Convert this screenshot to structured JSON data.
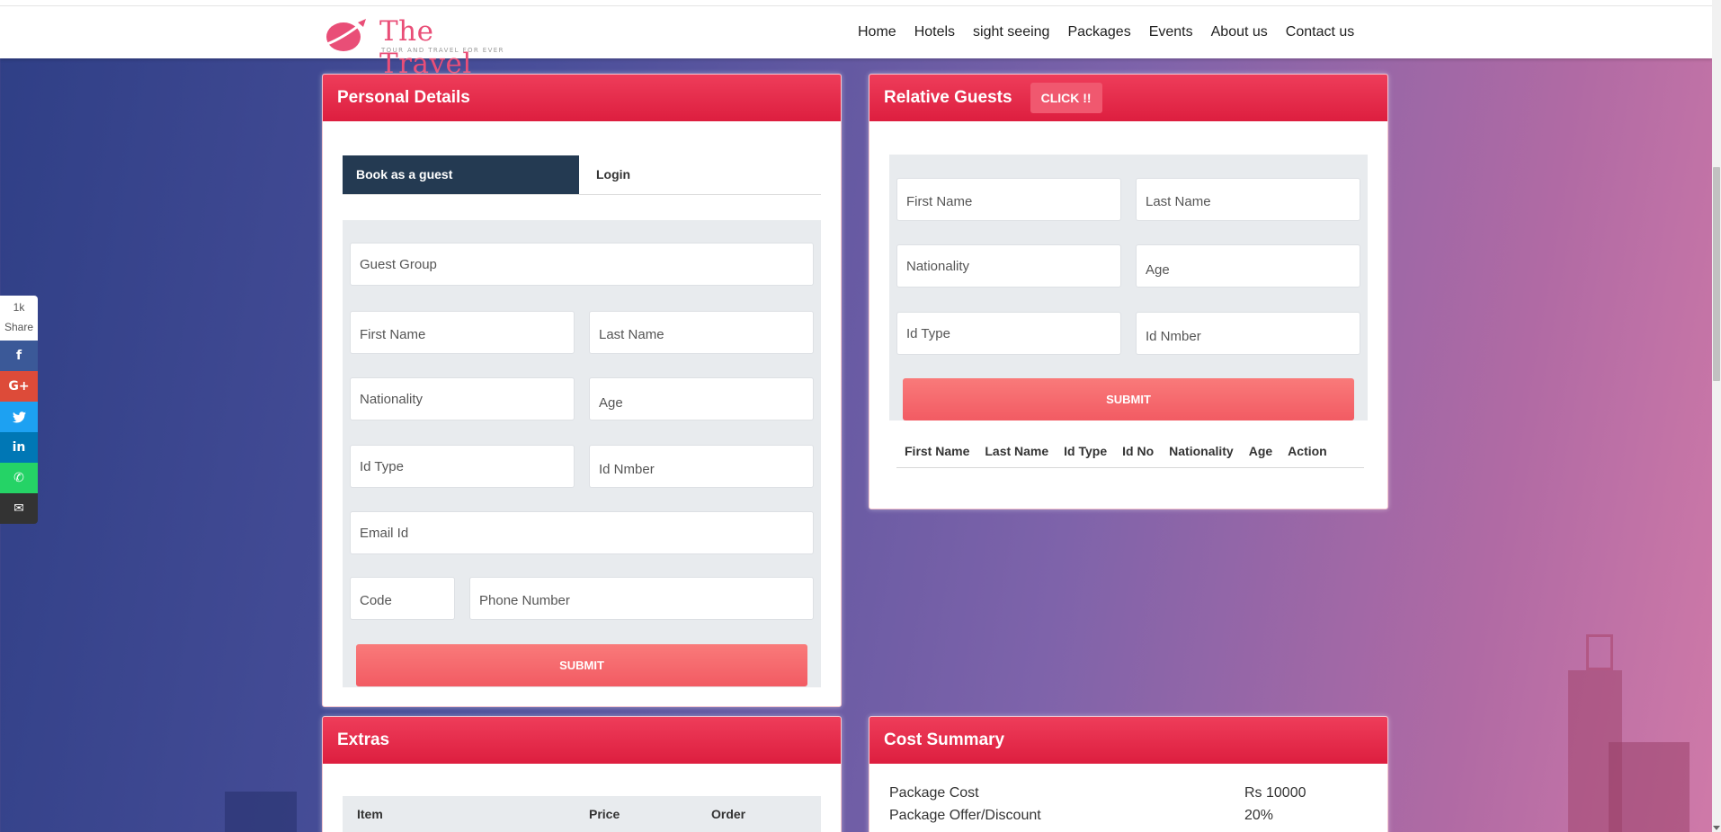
{
  "brand": {
    "title": "The Travel",
    "tagline": "TOUR AND TRAVEL FOR EVER",
    "color": "#e94e77"
  },
  "nav": [
    "Home",
    "Hotels",
    "sight seeing",
    "Packages",
    "Events",
    "About us",
    "Contact us"
  ],
  "share": {
    "count": "1k",
    "label": "Share",
    "buttons": [
      {
        "icon": "facebook-icon",
        "glyph": "f",
        "color": "#3b5998"
      },
      {
        "icon": "google-plus-icon",
        "glyph": "G+",
        "color": "#dd4b39"
      },
      {
        "icon": "twitter-icon",
        "glyph": "🐦",
        "color": "#1da1f2"
      },
      {
        "icon": "linkedin-icon",
        "glyph": "in",
        "color": "#0077b5"
      },
      {
        "icon": "whatsapp-icon",
        "glyph": "✆",
        "color": "#25d366"
      },
      {
        "icon": "email-icon",
        "glyph": "✉",
        "color": "#333333"
      }
    ]
  },
  "personal": {
    "title": "Personal Details",
    "tab_guest": "Book as a guest",
    "tab_login": "Login",
    "guest_group": "Guest Group",
    "first_name": "First Name",
    "last_name": "Last Name",
    "nationality": "Nationality",
    "age": "Age",
    "id_type": "Id Type",
    "id_number": "Id Nmber",
    "email": "Email Id",
    "code": "Code",
    "phone": "Phone Number",
    "submit": "SUBMIT"
  },
  "relative": {
    "title": "Relative Guests",
    "click": "CLICK !!",
    "first_name": "First Name",
    "last_name": "Last Name",
    "nationality": "Nationality",
    "age": "Age",
    "id_type": "Id Type",
    "id_number": "Id Nmber",
    "submit": "SUBMIT",
    "columns": [
      "First Name",
      "Last Name",
      "Id Type",
      "Id No",
      "Nationality",
      "Age",
      "Action"
    ]
  },
  "extras": {
    "title": "Extras",
    "columns": [
      "Item",
      "Price",
      "Order"
    ]
  },
  "cost": {
    "title": "Cost Summary",
    "rows": [
      {
        "label": "Package Cost",
        "value": "Rs 10000"
      },
      {
        "label": "Package Offer/Discount",
        "value": "20%"
      }
    ]
  },
  "colors": {
    "accent": "#e62b4a",
    "submit": "#f46a6e",
    "tab_active": "#243a52"
  }
}
